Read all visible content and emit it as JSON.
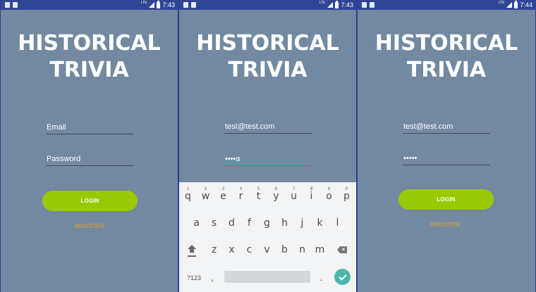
{
  "colors": {
    "status_bar": "#2f4596",
    "background": "#7289a1",
    "login_button": "#98c904",
    "register_link": "#f0a41d",
    "active_underline": "#c2506a",
    "keyboard_done": "#4db6ac"
  },
  "screens": [
    {
      "status": {
        "lte": "LTE",
        "time": "7:43"
      },
      "title_line1": "HISTORICAL",
      "title_line2": "TRIVIA",
      "email_placeholder": "Email",
      "email_value": "",
      "password_placeholder": "Password",
      "password_value": "",
      "login_label": "LOGIN",
      "register_label": "REGISTER"
    },
    {
      "status": {
        "lte": "LTE",
        "time": "7:43"
      },
      "title_line1": "HISTORICAL",
      "title_line2": "TRIVIA",
      "email_value": "test@test.com",
      "password_value": "••••a",
      "keyboard": {
        "row1": [
          {
            "key": "q",
            "hint": "1"
          },
          {
            "key": "w",
            "hint": "2"
          },
          {
            "key": "e",
            "hint": "3"
          },
          {
            "key": "r",
            "hint": "4"
          },
          {
            "key": "t",
            "hint": "5"
          },
          {
            "key": "y",
            "hint": "6"
          },
          {
            "key": "u",
            "hint": "7"
          },
          {
            "key": "i",
            "hint": "8"
          },
          {
            "key": "o",
            "hint": "9"
          },
          {
            "key": "p",
            "hint": "0"
          }
        ],
        "row2": [
          "a",
          "s",
          "d",
          "f",
          "g",
          "h",
          "j",
          "k",
          "l"
        ],
        "row3": [
          "z",
          "x",
          "c",
          "v",
          "b",
          "n",
          "m"
        ],
        "symbols_key": "?123",
        "comma_key": ",",
        "period_key": "."
      }
    },
    {
      "status": {
        "lte": "LTE",
        "time": "7:44"
      },
      "title_line1": "HISTORICAL",
      "title_line2": "TRIVIA",
      "email_value": "test@test.com",
      "password_value": "•••••",
      "login_label": "LOGIN",
      "register_label": "REGISTER"
    }
  ]
}
